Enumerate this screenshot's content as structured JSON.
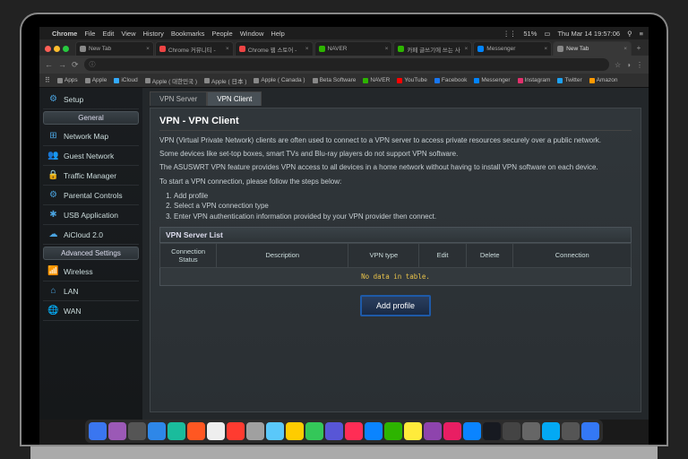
{
  "menubar": {
    "app": "Chrome",
    "items": [
      "File",
      "Edit",
      "View",
      "History",
      "Bookmarks",
      "People",
      "Window",
      "Help"
    ],
    "status": {
      "battery": "51%",
      "datetime": "Thu Mar 14  19:57:06"
    }
  },
  "browser": {
    "tabs": [
      {
        "label": "New Tab",
        "active": false,
        "fav": "#888"
      },
      {
        "label": "Chrome 커뮤니티 -",
        "active": false,
        "fav": "#e44"
      },
      {
        "label": "Chrome 웹 스토어 -",
        "active": false,
        "fav": "#e44"
      },
      {
        "label": "NAVER",
        "active": false,
        "fav": "#2db400"
      },
      {
        "label": "카페 글쓰기에 쓰는 사",
        "active": false,
        "fav": "#2db400"
      },
      {
        "label": "Messenger",
        "active": false,
        "fav": "#0084ff"
      },
      {
        "label": "New Tab",
        "active": true,
        "fav": "#888"
      }
    ],
    "url_icon": "ⓘ",
    "bookmarks": [
      {
        "label": "Apps",
        "color": "#888"
      },
      {
        "label": "Apple",
        "color": "#888"
      },
      {
        "label": "iCloud",
        "color": "#3af"
      },
      {
        "label": "Apple ( 대한민국 )",
        "color": "#888"
      },
      {
        "label": "Apple ( 日本 )",
        "color": "#888"
      },
      {
        "label": "Apple ( Canada )",
        "color": "#888"
      },
      {
        "label": "Beta Software",
        "color": "#888"
      },
      {
        "label": "NAVER",
        "color": "#2db400"
      },
      {
        "label": "YouTube",
        "color": "#f00"
      },
      {
        "label": "Facebook",
        "color": "#1877f2"
      },
      {
        "label": "Messenger",
        "color": "#0084ff"
      },
      {
        "label": "Instagram",
        "color": "#e1306c"
      },
      {
        "label": "Twitter",
        "color": "#1da1f2"
      },
      {
        "label": "Amazon",
        "color": "#f90"
      }
    ]
  },
  "router": {
    "setup": "Setup",
    "section_general": "General",
    "section_adv": "Advanced Settings",
    "general_items": [
      {
        "icon": "⊞",
        "label": "Network Map"
      },
      {
        "icon": "👥",
        "label": "Guest Network"
      },
      {
        "icon": "🔒",
        "label": "Traffic Manager"
      },
      {
        "icon": "⚙",
        "label": "Parental Controls"
      },
      {
        "icon": "✱",
        "label": "USB Application"
      },
      {
        "icon": "☁",
        "label": "AiCloud 2.0"
      }
    ],
    "adv_items": [
      {
        "icon": "📶",
        "label": "Wireless"
      },
      {
        "icon": "⌂",
        "label": "LAN"
      },
      {
        "icon": "🌐",
        "label": "WAN"
      }
    ],
    "page_tabs": {
      "server": "VPN Server",
      "client": "VPN Client"
    },
    "title": "VPN - VPN Client",
    "desc1": "VPN (Virtual Private Network) clients are often used to connect to a VPN server to access private resources securely over a public network.",
    "desc2": "Some devices like set-top boxes, smart TVs and Blu-ray players do not support VPN software.",
    "desc3": "The ASUSWRT VPN feature provides VPN access to all devices in a home network without having to install VPN software on each device.",
    "steps_intro": "To start a VPN connection, please follow the steps below:",
    "steps": [
      "Add profile",
      "Select a VPN connection type",
      "Enter VPN authentication information provided by your VPN provider then connect."
    ],
    "table": {
      "caption": "VPN Server List",
      "headers": [
        "Connection Status",
        "Description",
        "VPN type",
        "Edit",
        "Delete",
        "Connection"
      ],
      "empty": "No data in table."
    },
    "add_profile": "Add profile"
  },
  "dock_apps": [
    {
      "c": "#3a76f0"
    },
    {
      "c": "#9b59b6"
    },
    {
      "c": "#555"
    },
    {
      "c": "#2e87e8"
    },
    {
      "c": "#1abc9c"
    },
    {
      "c": "#ff5722"
    },
    {
      "c": "#eee"
    },
    {
      "c": "#ff3b30"
    },
    {
      "c": "#a0a0a0"
    },
    {
      "c": "#5ac8fa"
    },
    {
      "c": "#ffcc00"
    },
    {
      "c": "#34c759"
    },
    {
      "c": "#5856d6"
    },
    {
      "c": "#ff2d55"
    },
    {
      "c": "#0a84ff"
    },
    {
      "c": "#2db400"
    },
    {
      "c": "#ffeb3b"
    },
    {
      "c": "#8e44ad"
    },
    {
      "c": "#e91e63"
    },
    {
      "c": "#0a84ff"
    },
    {
      "c": "#171a21"
    },
    {
      "c": "#444"
    },
    {
      "c": "#666"
    },
    {
      "c": "#03a9f4"
    },
    {
      "c": "#555"
    },
    {
      "c": "#3478f6"
    }
  ]
}
